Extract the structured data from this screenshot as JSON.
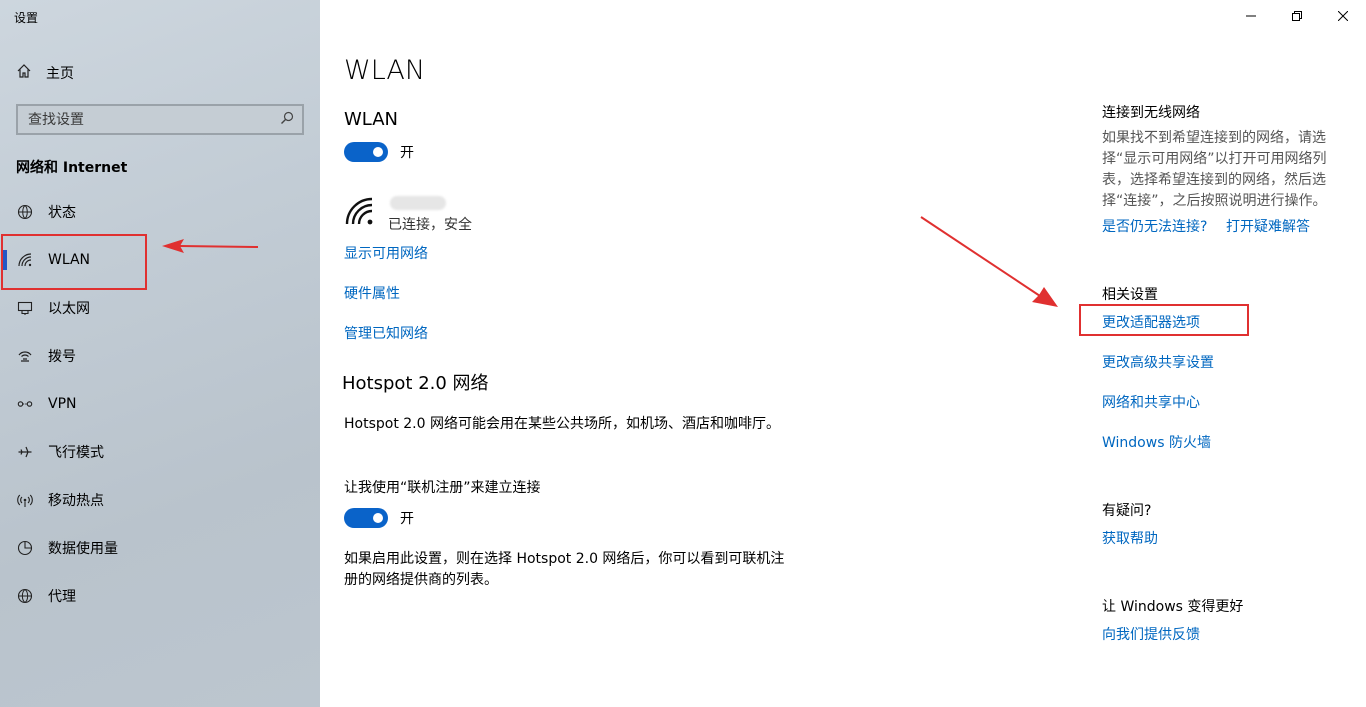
{
  "app_title": "设置",
  "sidebar": {
    "home_label": "主页",
    "search_placeholder": "查找设置",
    "section_title": "网络和 Internet",
    "items": [
      {
        "label": "状态",
        "icon": "globe-status-icon"
      },
      {
        "label": "WLAN",
        "icon": "wifi-icon"
      },
      {
        "label": "以太网",
        "icon": "ethernet-icon"
      },
      {
        "label": "拨号",
        "icon": "dialup-icon"
      },
      {
        "label": "VPN",
        "icon": "vpn-icon"
      },
      {
        "label": "飞行模式",
        "icon": "airplane-icon"
      },
      {
        "label": "移动热点",
        "icon": "hotspot-icon"
      },
      {
        "label": "数据使用量",
        "icon": "data-usage-icon"
      },
      {
        "label": "代理",
        "icon": "proxy-icon"
      }
    ]
  },
  "main": {
    "page_title": "WLAN",
    "wlan_heading": "WLAN",
    "wlan_toggle": "开",
    "network_status": "已连接，安全",
    "links": [
      "显示可用网络",
      "硬件属性",
      "管理已知网络"
    ],
    "hotspot_heading": "Hotspot 2.0 网络",
    "hotspot_desc": "Hotspot 2.0 网络可能会用在某些公共场所，如机场、酒店和咖啡厅。",
    "hotspot_option": "让我使用“联机注册”来建立连接",
    "hotspot_toggle": "开",
    "hotspot_note": "如果启用此设置，则在选择 Hotspot 2.0 网络后，你可以看到可联机注册的网络提供商的列表。"
  },
  "right": {
    "connect_heading": "连接到无线网络",
    "connect_desc": "如果找不到希望连接到的网络，请选择“显示可用网络”以打开可用网络列表，选择希望连接到的网络，然后选择“连接”，之后按照说明进行操作。",
    "connect_q": "是否仍无法连接?",
    "connect_link": "打开疑难解答",
    "related_heading": "相关设置",
    "related_links": [
      "更改适配器选项",
      "更改高级共享设置",
      "网络和共享中心",
      "Windows 防火墙"
    ],
    "help_heading": "有疑问?",
    "help_link": "获取帮助",
    "feedback_heading": "让 Windows 变得更好",
    "feedback_link": "向我们提供反馈"
  },
  "colors": {
    "accent": "#0067c0",
    "toggle_on": "#0a63c9",
    "annotation": "#e03030"
  }
}
